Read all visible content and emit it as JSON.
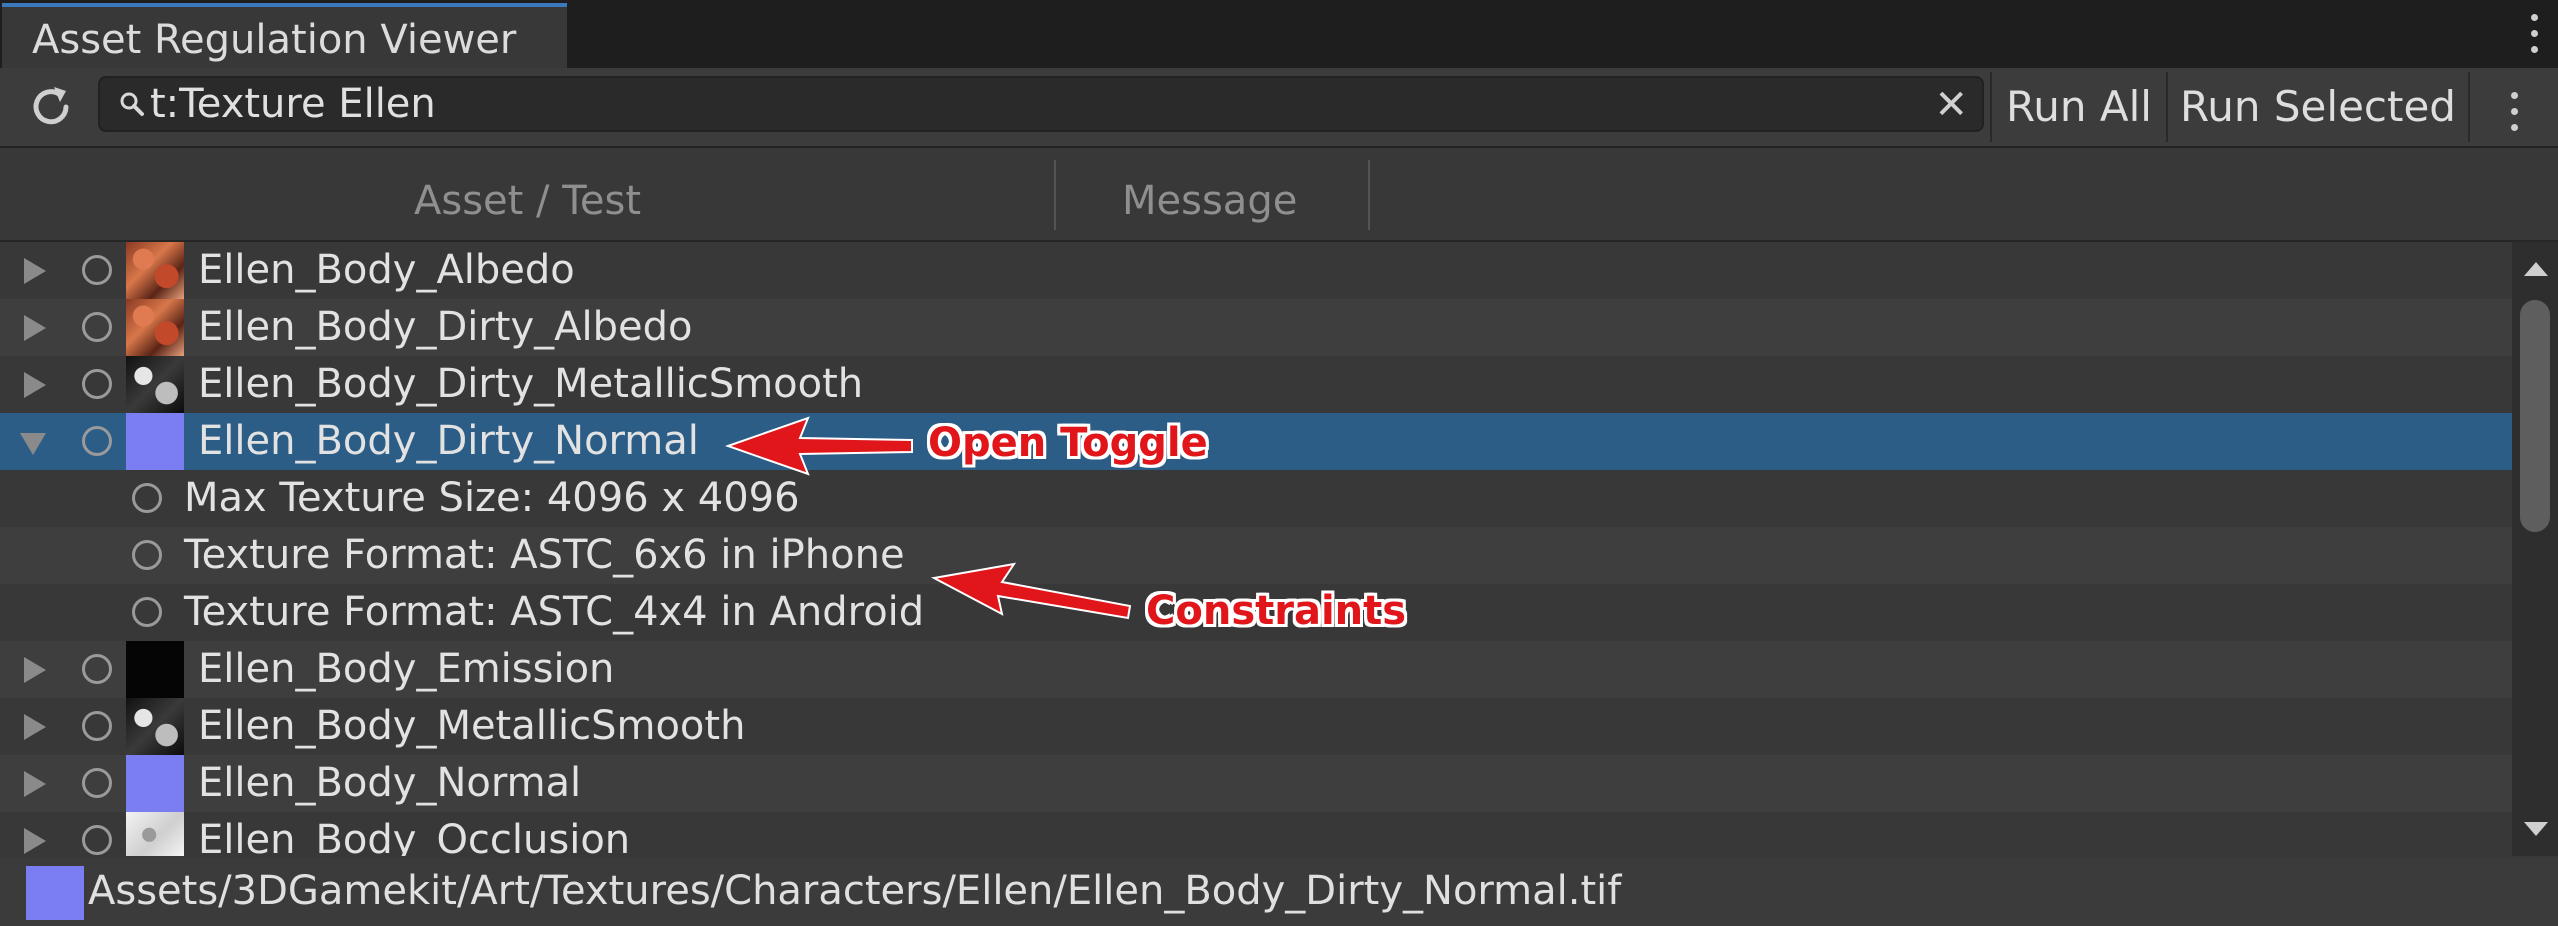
{
  "window": {
    "tab_title": "Asset Regulation Viewer",
    "menu_icon": "vertical-ellipsis-icon"
  },
  "toolbar": {
    "refresh_icon": "refresh-icon",
    "search_value": "t:Texture Ellen",
    "search_icon": "search-icon",
    "clear_glyph": "✕",
    "run_all_label": "Run All",
    "run_selected_label": "Run Selected"
  },
  "header": {
    "col_asset": "Asset / Test",
    "col_message": "Message"
  },
  "tree": {
    "rows": [
      {
        "label": "Ellen_Body_Albedo",
        "kind": "asset",
        "expanded": false,
        "thumb": "albedo"
      },
      {
        "label": "Ellen_Body_Dirty_Albedo",
        "kind": "asset",
        "expanded": false,
        "thumb": "albedo"
      },
      {
        "label": "Ellen_Body_Dirty_MetallicSmooth",
        "kind": "asset",
        "expanded": false,
        "thumb": "metallic"
      },
      {
        "label": "Ellen_Body_Dirty_Normal",
        "kind": "asset",
        "expanded": true,
        "selected": true,
        "thumb": "normal"
      },
      {
        "label": "Max Texture Size: 4096 x 4096",
        "kind": "test"
      },
      {
        "label": "Texture Format: ASTC_6x6 in iPhone",
        "kind": "test"
      },
      {
        "label": "Texture Format: ASTC_4x4 in Android",
        "kind": "test"
      },
      {
        "label": "Ellen_Body_Emission",
        "kind": "asset",
        "expanded": false,
        "thumb": "emission"
      },
      {
        "label": "Ellen_Body_MetallicSmooth",
        "kind": "asset",
        "expanded": false,
        "thumb": "metallic"
      },
      {
        "label": "Ellen_Body_Normal",
        "kind": "asset",
        "expanded": false,
        "thumb": "normal"
      },
      {
        "label": "Ellen_Body_Occlusion",
        "kind": "asset",
        "expanded": false,
        "thumb": "occlusion"
      }
    ]
  },
  "status": {
    "path": "Assets/3DGamekit/Art/Textures/Characters/Ellen/Ellen_Body_Dirty_Normal.tif"
  },
  "annotations": {
    "open_toggle": "Open Toggle",
    "constraints": "Constraints"
  },
  "colors": {
    "selection": "#2c5d87",
    "normal_map": "#7a7ef0",
    "annotation_red": "#e0161b",
    "tab_accent": "#3a79bb"
  }
}
